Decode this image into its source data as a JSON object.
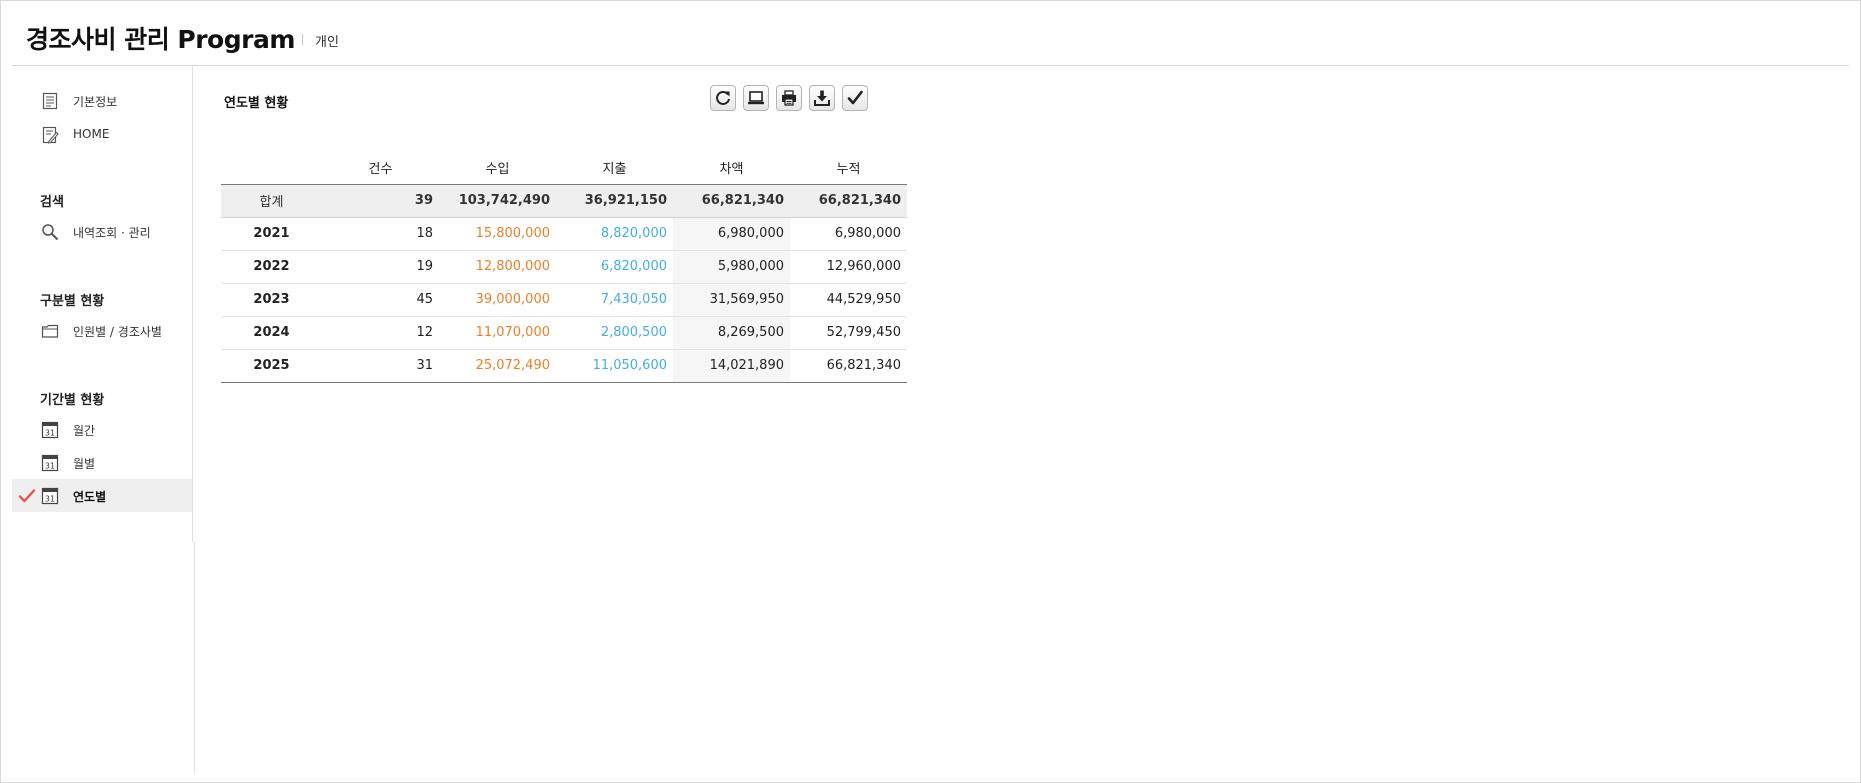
{
  "app": {
    "title": "경조사비 관리 Program",
    "mode": "개인"
  },
  "sidebar": {
    "top_items": [
      {
        "label": "기본정보",
        "icon": "document-icon"
      },
      {
        "label": "HOME",
        "icon": "edit-document-icon"
      }
    ],
    "groups": [
      {
        "title": "검색",
        "items": [
          {
            "label": "내역조회 · 관리",
            "icon": "search-icon"
          }
        ]
      },
      {
        "title": "구분별 현황",
        "items": [
          {
            "label": "인원별 / 경조사별",
            "icon": "folder-icon"
          }
        ]
      },
      {
        "title": "기간별 현황",
        "items": [
          {
            "label": "월간",
            "icon": "calendar-icon"
          },
          {
            "label": "월별",
            "icon": "calendar-icon"
          },
          {
            "label": "연도별",
            "icon": "calendar-icon",
            "active": true
          }
        ]
      }
    ]
  },
  "content": {
    "title": "연도별 현황",
    "toolbar": [
      "refresh-icon",
      "monitor-icon",
      "print-icon",
      "download-icon",
      "check-icon"
    ]
  },
  "table": {
    "columns": [
      "",
      "건수",
      "수입",
      "지출",
      "차액",
      "누적"
    ],
    "total": {
      "label": "합계",
      "count": "39",
      "income": "103,742,490",
      "expense": "36,921,150",
      "diff": "66,821,340",
      "cumulative": "66,821,340"
    },
    "rows": [
      {
        "label": "2021",
        "count": "18",
        "income": "15,800,000",
        "expense": "8,820,000",
        "diff": "6,980,000",
        "cumulative": "6,980,000"
      },
      {
        "label": "2022",
        "count": "19",
        "income": "12,800,000",
        "expense": "6,820,000",
        "diff": "5,980,000",
        "cumulative": "12,960,000"
      },
      {
        "label": "2023",
        "count": "45",
        "income": "39,000,000",
        "expense": "7,430,050",
        "diff": "31,569,950",
        "cumulative": "44,529,950"
      },
      {
        "label": "2024",
        "count": "12",
        "income": "11,070,000",
        "expense": "2,800,500",
        "diff": "8,269,500",
        "cumulative": "52,799,450"
      },
      {
        "label": "2025",
        "count": "31",
        "income": "25,072,490",
        "expense": "11,050,600",
        "diff": "14,021,890",
        "cumulative": "66,821,340"
      }
    ]
  },
  "colors": {
    "income": "#e8822a",
    "expense": "#45aee0",
    "active_check": "#e8554e"
  }
}
